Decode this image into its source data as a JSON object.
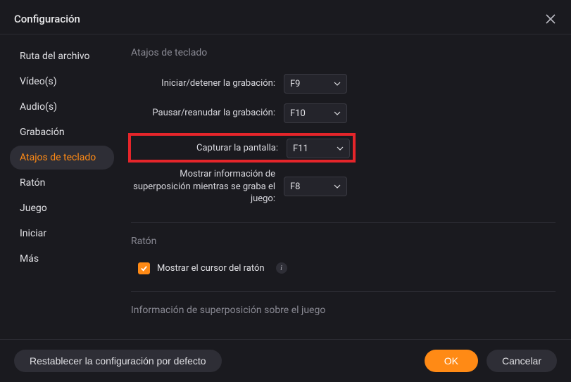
{
  "title": "Configuración",
  "sidebar": {
    "items": [
      {
        "label": "Ruta del archivo"
      },
      {
        "label": "Vídeo(s)"
      },
      {
        "label": "Audio(s)"
      },
      {
        "label": "Grabación"
      },
      {
        "label": "Atajos de teclado",
        "active": true
      },
      {
        "label": "Ratón"
      },
      {
        "label": "Juego"
      },
      {
        "label": "Iniciar"
      },
      {
        "label": "Más"
      }
    ]
  },
  "sections": {
    "shortcuts": {
      "heading": "Atajos de teclado",
      "rows": [
        {
          "label": "Iniciar/detener la grabación:",
          "value": "F9"
        },
        {
          "label": "Pausar/reanudar la grabación:",
          "value": "F10"
        },
        {
          "label": "Capturar la pantalla:",
          "value": "F11",
          "highlighted": true
        },
        {
          "label": "Mostrar información de superposición mientras se graba el juego:",
          "value": "F8"
        }
      ]
    },
    "mouse": {
      "heading": "Ratón",
      "checkbox_label": "Mostrar el cursor del ratón"
    },
    "overlay": {
      "heading": "Información de superposición sobre el juego"
    }
  },
  "footer": {
    "reset": "Restablecer la configuración por defecto",
    "ok": "OK",
    "cancel": "Cancelar"
  }
}
